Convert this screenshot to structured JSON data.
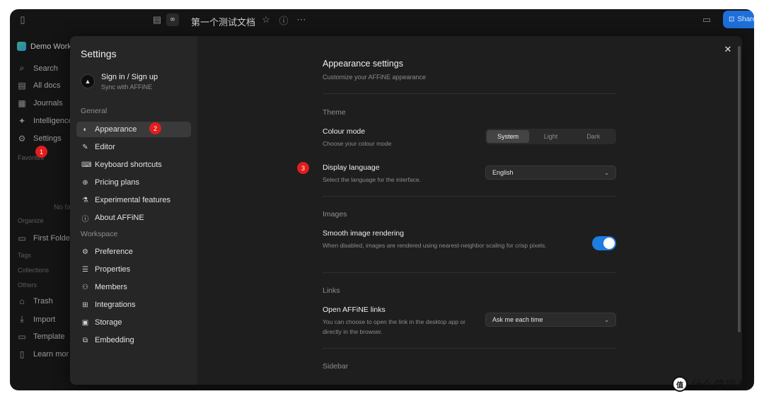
{
  "doc_title": "第一个测试文档",
  "share_label": "Share",
  "sidebar": {
    "workspace": "Demo Work",
    "items": [
      {
        "icon": "search-icon",
        "glyph": "⌕",
        "label": "Search"
      },
      {
        "icon": "docs-icon",
        "glyph": "▤",
        "label": "All docs"
      },
      {
        "icon": "calendar-icon",
        "glyph": "▦",
        "label": "Journals"
      },
      {
        "icon": "sparkle-icon",
        "glyph": "✦",
        "label": "Intelligence"
      },
      {
        "icon": "gear-icon",
        "glyph": "⚙",
        "label": "Settings"
      }
    ],
    "favorites": "Favorites",
    "empty_text": "No fa",
    "organize": "Organize",
    "folder": "First Folde",
    "tags": "Tags",
    "collections": "Collections",
    "others": "Others",
    "bottom_items": [
      {
        "icon": "trash-icon",
        "glyph": "🗑",
        "label": "Trash"
      },
      {
        "icon": "import-icon",
        "glyph": "⤓",
        "label": "Import"
      },
      {
        "icon": "template-icon",
        "glyph": "▭",
        "label": "Template"
      },
      {
        "icon": "book-icon",
        "glyph": "▯",
        "label": "Learn mor"
      }
    ]
  },
  "settings": {
    "title": "Settings",
    "account_name": "Sign in / Sign up",
    "account_sub": "Sync with AFFiNE",
    "general_label": "General",
    "general_items": [
      {
        "name": "appearance",
        "glyph": "◐",
        "label": "Appearance"
      },
      {
        "name": "editor",
        "glyph": "✎",
        "label": "Editor"
      },
      {
        "name": "keyboard-shortcuts",
        "glyph": "⌨",
        "label": "Keyboard shortcuts"
      },
      {
        "name": "pricing-plans",
        "glyph": "⊕",
        "label": "Pricing plans"
      },
      {
        "name": "experimental-features",
        "glyph": "⚗",
        "label": "Experimental features"
      },
      {
        "name": "about-affine",
        "glyph": "ⓘ",
        "label": "About AFFiNE"
      }
    ],
    "workspace_label": "Workspace",
    "workspace_items": [
      {
        "name": "preference",
        "glyph": "⚙",
        "label": "Preference"
      },
      {
        "name": "properties",
        "glyph": "☰",
        "label": "Properties"
      },
      {
        "name": "members",
        "glyph": "⚇",
        "label": "Members"
      },
      {
        "name": "integrations",
        "glyph": "⊞",
        "label": "Integrations"
      },
      {
        "name": "storage",
        "glyph": "▣",
        "label": "Storage"
      },
      {
        "name": "embedding",
        "glyph": "⧉",
        "label": "Embedding"
      }
    ]
  },
  "appearance": {
    "title": "Appearance settings",
    "subtitle": "Customize your AFFiNE appearance",
    "theme_group": "Theme",
    "colour_mode_label": "Colour mode",
    "colour_mode_desc": "Choose your colour mode",
    "colour_options": [
      "System",
      "Light",
      "Dark"
    ],
    "colour_selected": "System",
    "language_label": "Display language",
    "language_desc": "Select the language for the interface.",
    "language_value": "English",
    "images_group": "Images",
    "smooth_label": "Smooth image rendering",
    "smooth_desc": "When disabled, images are rendered using nearest-neighbor scaling for crisp pixels.",
    "smooth_enabled": true,
    "links_group": "Links",
    "links_label": "Open AFFiNE links",
    "links_desc": "You can choose to open the link in the desktop app or directly in the browser.",
    "links_value": "Ask me each time",
    "sidebar_group": "Sidebar"
  },
  "badges": {
    "one": "1",
    "two": "2",
    "three": "3"
  },
  "watermark": "什么值得买",
  "colors": {
    "accent": "#1e7de0",
    "badge": "#e21d1d",
    "modal": "#1e1e1e",
    "nav": "#262626"
  }
}
